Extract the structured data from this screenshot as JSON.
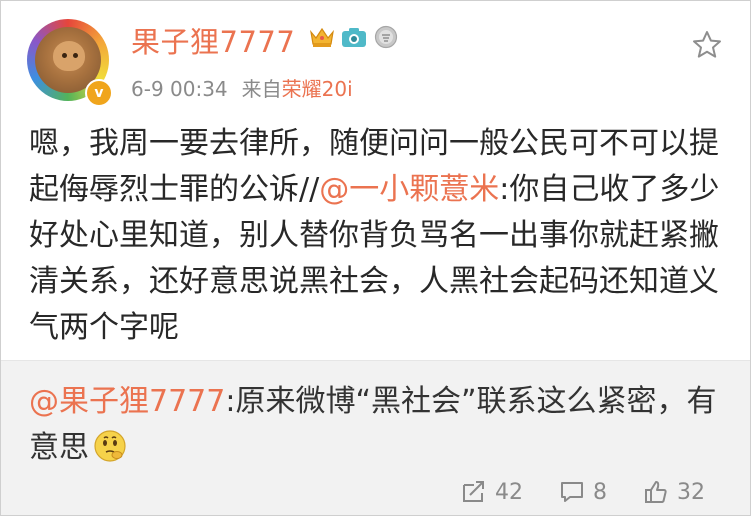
{
  "post": {
    "username": "果子狸7777",
    "time": "6-9 00:34",
    "source_prefix": "来自",
    "source": "荣耀20i",
    "badges": [
      "crown-icon",
      "camera-icon",
      "medal-icon"
    ],
    "verify_badge": "v",
    "text_before_mention": "嗯，我周一要去律所，随便问问一般公民可不可以提起侮辱烈士罪的公诉//",
    "mention": "@一小颗薏米",
    "text_after_mention": ":你自己收了多少好处心里知道，别人替你背负骂名一出事你就赶紧撇清关系，还好意思说黑社会，人黑社会起码还知道义气两个字呢"
  },
  "repost": {
    "mention": "@果子狸7777",
    "text": ":原来微博“黑社会”联系这么紧密，有意思",
    "emoji": "thinking-emoji"
  },
  "actions": {
    "repost_count": "42",
    "comment_count": "8",
    "like_count": "32"
  },
  "colors": {
    "accent": "#eb7350",
    "text": "#282828",
    "meta": "#8a8a8a",
    "repost_bg": "#f2f2f2"
  }
}
